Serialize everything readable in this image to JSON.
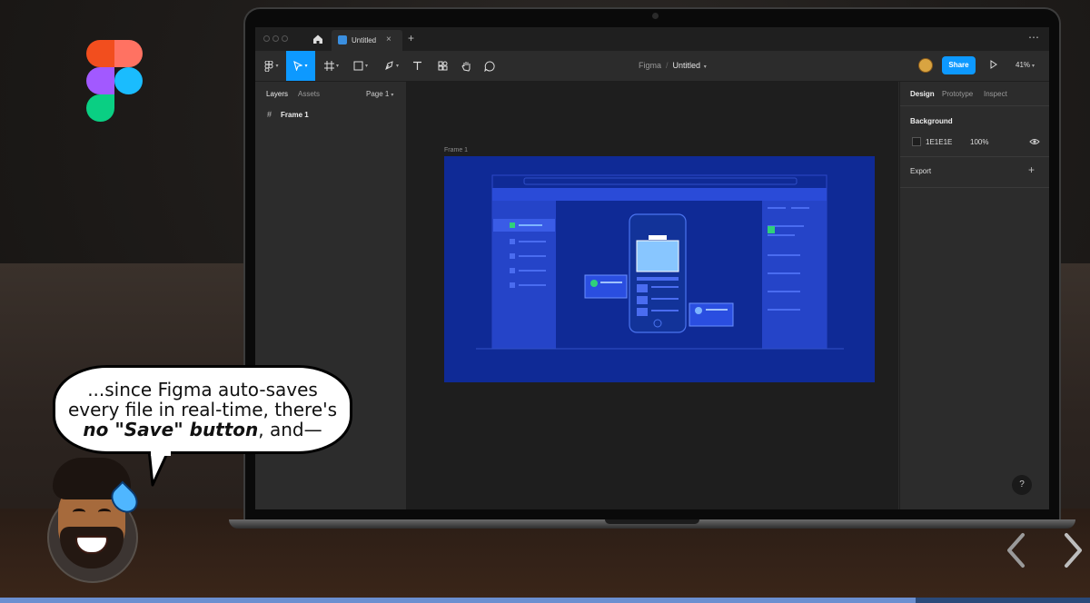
{
  "tabbar": {
    "tab_label": "Untitled",
    "close_glyph": "×",
    "new_tab_glyph": "+",
    "more_glyph": "⋯"
  },
  "toolbar": {
    "project": "Figma",
    "separator": "/",
    "file_name": "Untitled",
    "share_label": "Share",
    "zoom": "41%",
    "tools": [
      "figma-menu-icon",
      "move-tool-icon",
      "frame-tool-icon",
      "rectangle-tool-icon",
      "pen-tool-icon",
      "text-tool-icon",
      "resources-icon",
      "hand-tool-icon",
      "comment-icon"
    ]
  },
  "left_panel": {
    "tabs": [
      "Layers",
      "Assets"
    ],
    "page": "Page 1",
    "layers": [
      {
        "icon": "#",
        "label": "Frame 1"
      }
    ]
  },
  "canvas": {
    "frame_label": "Frame 1",
    "frame_color": "#0f2a96"
  },
  "right_panel": {
    "tabs": [
      "Design",
      "Prototype",
      "Inspect"
    ],
    "background_title": "Background",
    "bg_hex": "1E1E1E",
    "bg_opacity": "100%",
    "export_title": "Export",
    "help_label": "?"
  },
  "bubble": {
    "line1": "...since Figma auto-saves",
    "line2": "every file in real-time, there's",
    "line3_bold": "no \"Save\" button",
    "line3_rest": ", and—"
  },
  "colors": {
    "accent": "#0d99ff",
    "panel": "#2c2c2c",
    "canvas": "#1e1e1e"
  },
  "video_progress": 0.84
}
